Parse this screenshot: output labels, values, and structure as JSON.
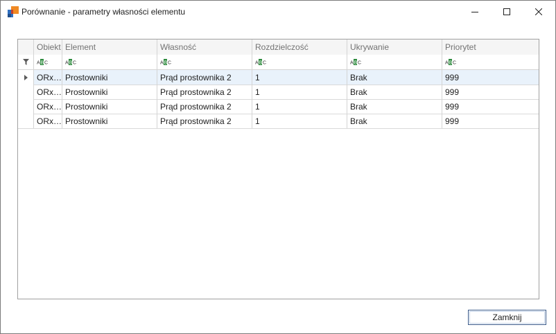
{
  "window": {
    "title": "Porównanie - parametry własności elementu",
    "icon": "app-logo-icon",
    "controls": [
      "minimize-icon",
      "maximize-icon",
      "close-icon"
    ]
  },
  "grid": {
    "columns": [
      "Obiekt",
      "Element",
      "Własność",
      "Rozdzielczość",
      "Ukrywanie",
      "Priorytet"
    ],
    "filter_icon": "filter-icon",
    "filter_cell_icon": "abc-text-filter-icon",
    "rows": [
      [
        "ORx…",
        "Prostowniki",
        "Prąd prostownika 2",
        "1",
        "Brak",
        "999"
      ],
      [
        "ORx…",
        "Prostowniki",
        "Prąd prostownika 2",
        "1",
        "Brak",
        "999"
      ],
      [
        "ORx…",
        "Prostowniki",
        "Prąd prostownika 2",
        "1",
        "Brak",
        "999"
      ],
      [
        "ORx…",
        "Prostowniki",
        "Prąd prostownika 2",
        "1",
        "Brak",
        "999"
      ]
    ],
    "focused_row": 0
  },
  "footer": {
    "close_label": "Zamknij"
  },
  "colors": {
    "focused_row": "#e9f2fb",
    "grid_lines": "#d4d4d4",
    "header_text": "#737373",
    "button_border": "#3a5a8a"
  }
}
